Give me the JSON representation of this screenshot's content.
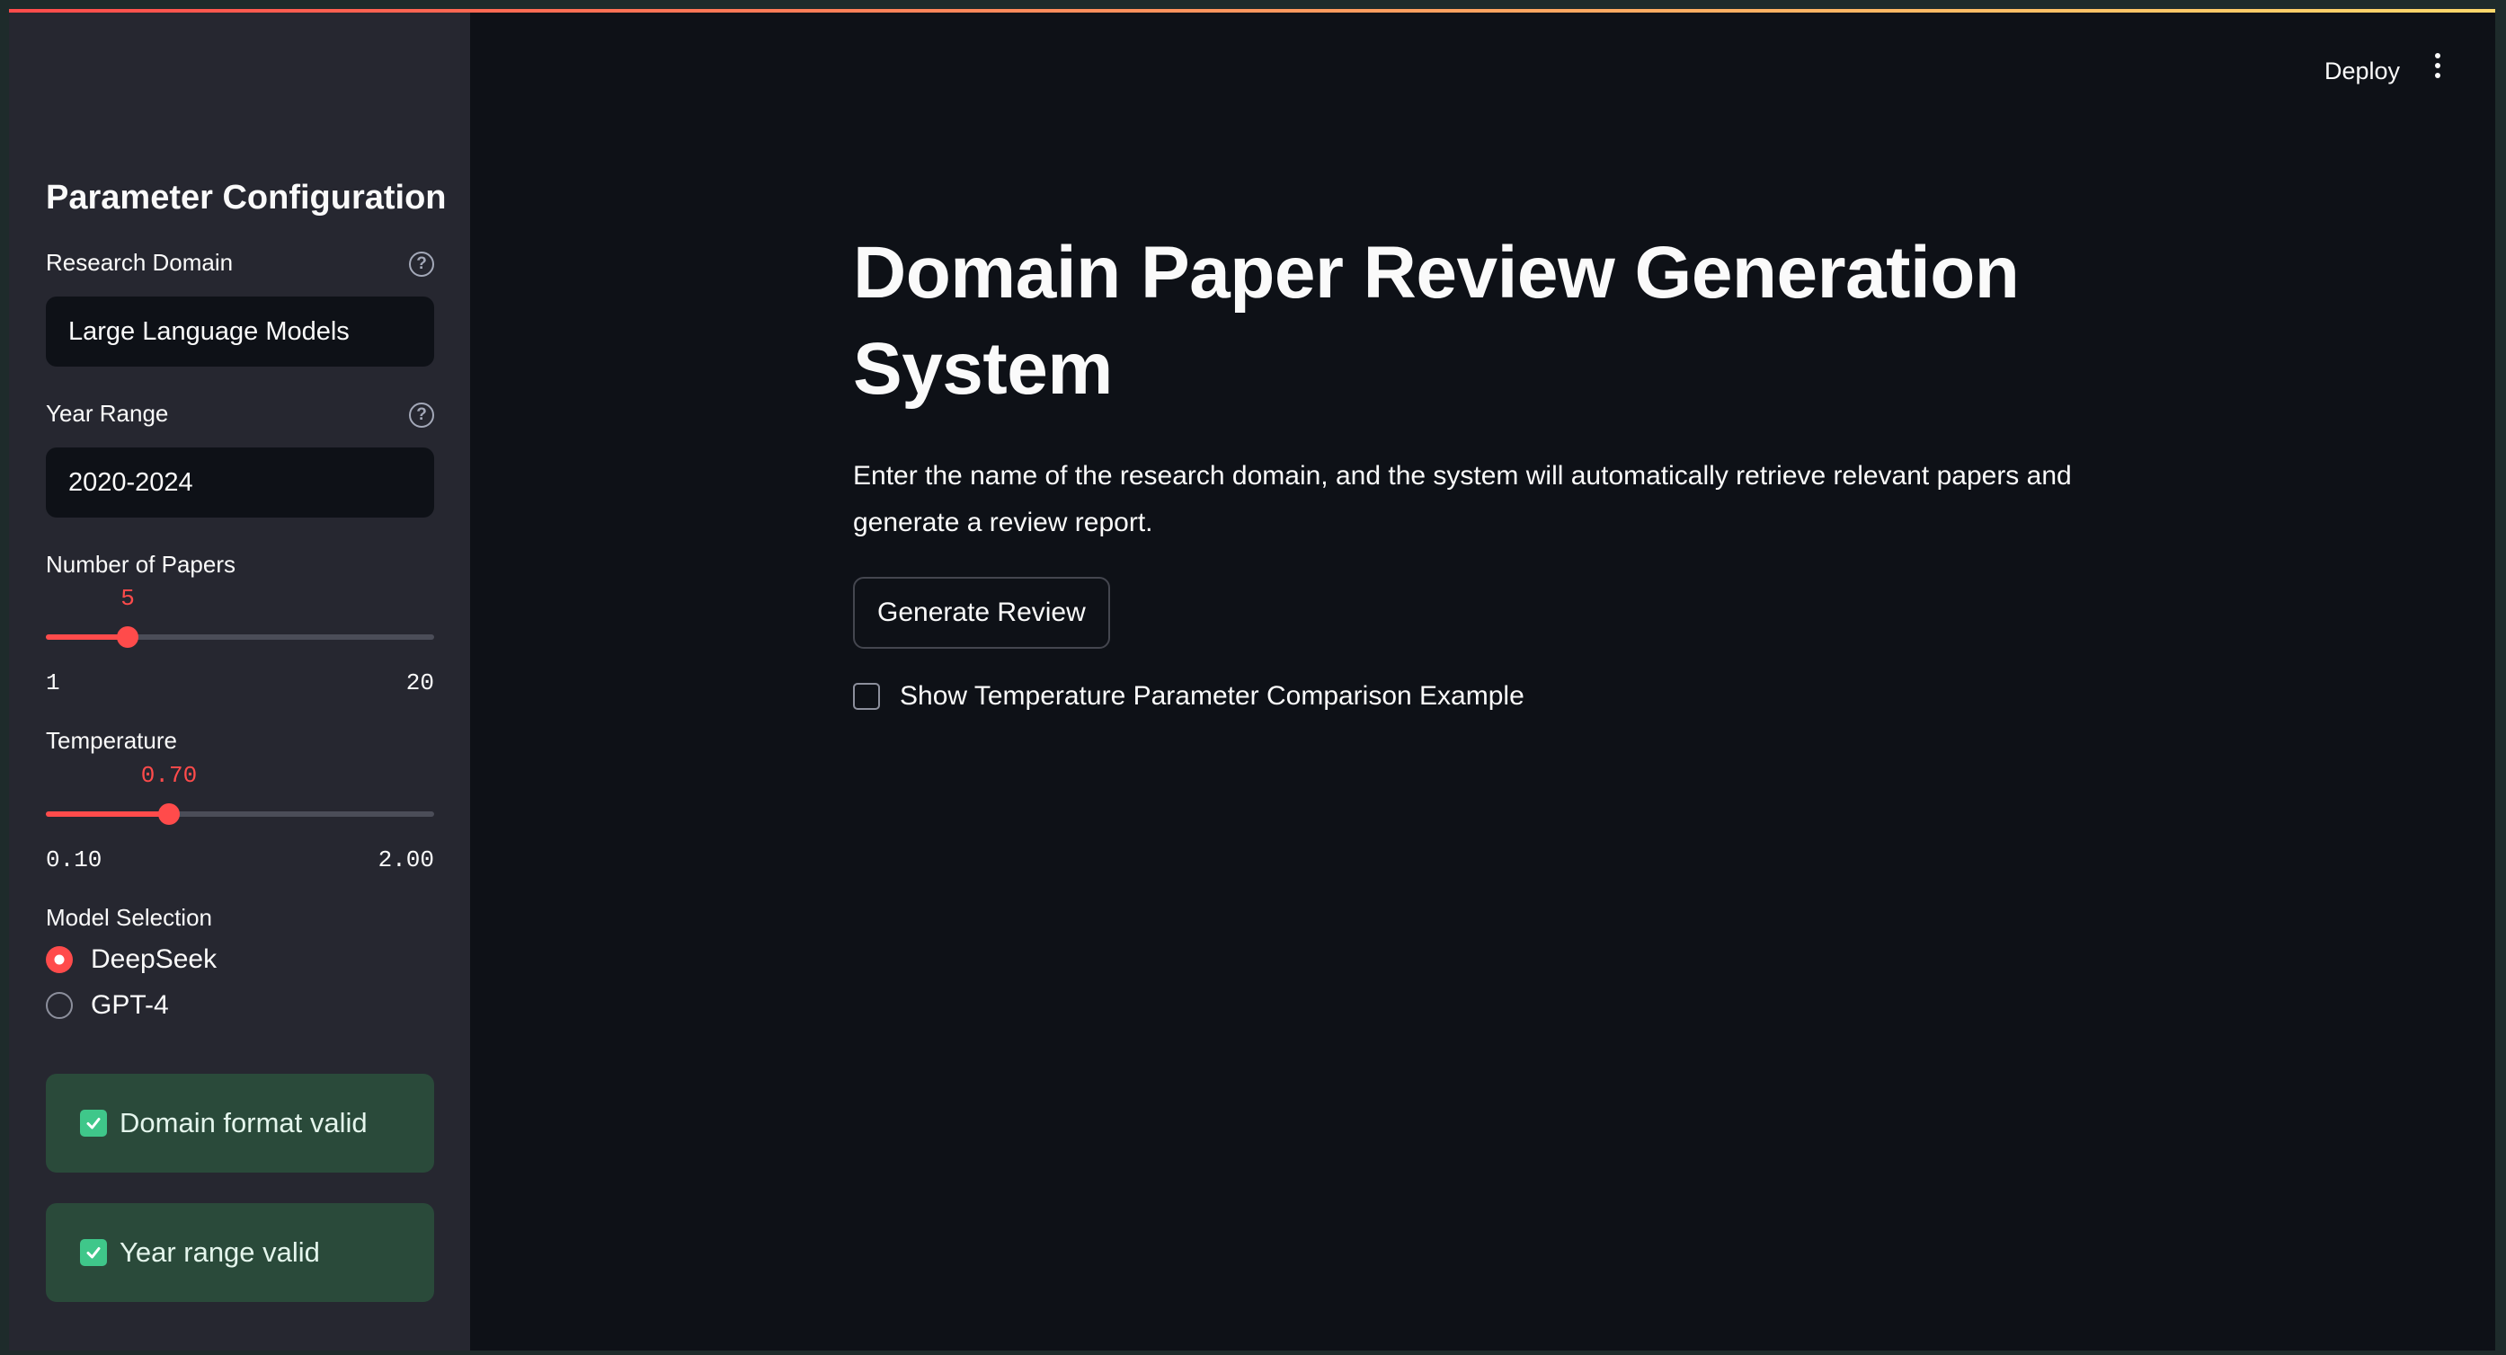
{
  "sidebar": {
    "title": "Parameter Configuration",
    "research_domain": {
      "label": "Research Domain",
      "value": "Large Language Models",
      "help": "?"
    },
    "year_range": {
      "label": "Year Range",
      "value": "2020-2024",
      "help": "?"
    },
    "num_papers": {
      "label": "Number of Papers",
      "value": "5",
      "min": "1",
      "max": "20",
      "fraction": 0.2105
    },
    "temperature": {
      "label": "Temperature",
      "value": "0.70",
      "min": "0.10",
      "max": "2.00",
      "fraction": 0.3175
    },
    "model": {
      "label": "Model Selection",
      "options": [
        {
          "label": "DeepSeek",
          "selected": true
        },
        {
          "label": "GPT-4",
          "selected": false
        }
      ]
    },
    "alerts": [
      {
        "text": "Domain format valid"
      },
      {
        "text": "Year range valid"
      }
    ]
  },
  "header": {
    "deploy_label": "Deploy"
  },
  "main": {
    "title": "Domain Paper Review Generation System",
    "description": "Enter the name of the research domain, and the system will automatically retrieve relevant papers and generate a review report.",
    "generate_button": "Generate Review",
    "checkbox_label": "Show Temperature Parameter Comparison Example"
  },
  "colors": {
    "accent": "#ff4b4b",
    "sidebar_bg": "#262730",
    "main_bg": "#0e1117",
    "success_bg": "#2a4a3a",
    "success_check": "#3fc78a"
  }
}
